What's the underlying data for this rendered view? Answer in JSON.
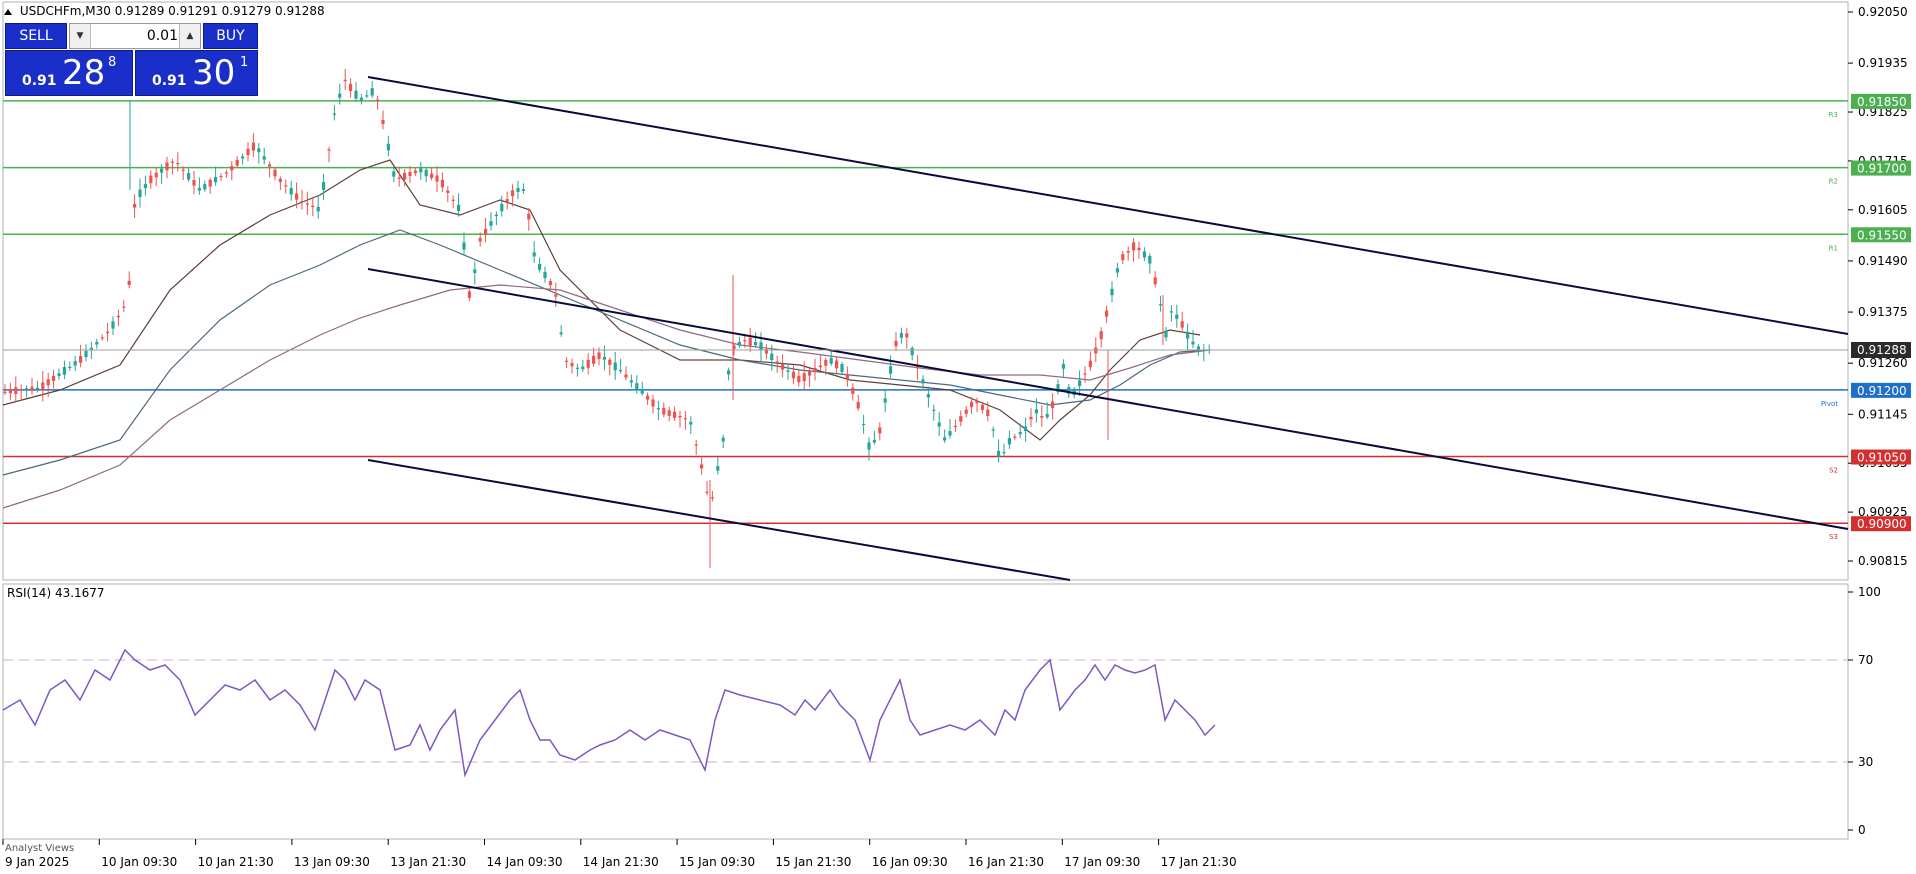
{
  "header": {
    "symbol": "USDCHFm,M30",
    "ohlc": "0.91289 0.91291 0.91279 0.91288"
  },
  "trade_panel": {
    "sell_label": "SELL",
    "buy_label": "BUY",
    "lot_value": "0.01",
    "sell_price": {
      "small": "0.91",
      "big": "28",
      "sup": "8"
    },
    "buy_price": {
      "small": "0.91",
      "big": "30",
      "sup": "1"
    }
  },
  "price_axis": [
    "0.92050",
    "0.91935",
    "0.91825",
    "0.91715",
    "0.91605",
    "0.91490",
    "0.91375",
    "0.91260",
    "0.91145",
    "0.91035",
    "0.90925",
    "0.90815"
  ],
  "levels": [
    {
      "price": "0.91850",
      "short": "R3",
      "color": "#4caf50"
    },
    {
      "price": "0.91700",
      "short": "R2",
      "color": "#4caf50"
    },
    {
      "price": "0.91550",
      "short": "R1",
      "color": "#4caf50"
    },
    {
      "price": "0.91200",
      "short": "Pivot",
      "color": "#1e6fc8"
    },
    {
      "price": "0.91050",
      "short": "S2",
      "color": "#d32f2f"
    },
    {
      "price": "0.90900",
      "short": "S3",
      "color": "#d32f2f"
    }
  ],
  "current_price": {
    "label": "0.91288",
    "color": "#2b2b2b"
  },
  "rsi": {
    "label": "RSI(14) 43.1677",
    "axis": [
      "100",
      "70",
      "30",
      "0"
    ]
  },
  "time_axis": [
    "9 Jan 2025",
    "10 Jan 09:30",
    "10 Jan 21:30",
    "13 Jan 09:30",
    "13 Jan 21:30",
    "14 Jan 09:30",
    "14 Jan 21:30",
    "15 Jan 09:30",
    "15 Jan 21:30",
    "16 Jan 09:30",
    "16 Jan 21:30",
    "17 Jan 09:30",
    "17 Jan 21:30"
  ],
  "bottom_tab": "Analyst Views",
  "colors": {
    "bull": "#26a69a",
    "bear": "#ef5350",
    "channel": "#0a0a3c",
    "rsi_line": "#7e57c2",
    "ma_dark": "#5d4037",
    "ma_mauve": "#8e6a86",
    "ma_slate": "#4a6a78"
  }
}
